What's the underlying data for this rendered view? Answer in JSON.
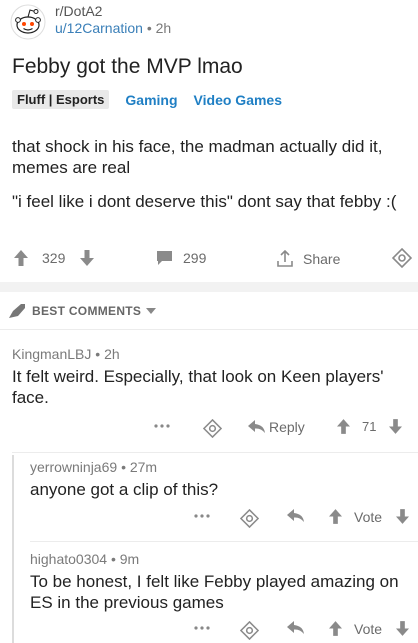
{
  "post": {
    "subreddit": "r/DotA2",
    "author": "u/12Carnation",
    "age": "2h",
    "title": "Febby got the MVP lmao",
    "flair": "Fluff | Esports",
    "tags": [
      "Gaming",
      "Video Games"
    ],
    "body": [
      "that shock in his face, the madman actually did it, memes are real",
      "\"i feel like i dont deserve this\" dont say that febby :("
    ],
    "score": "329",
    "comments": "299",
    "share_label": "Share"
  },
  "sort": {
    "label": "BEST COMMENTS"
  },
  "comments": [
    {
      "author": "KingmanLBJ",
      "age": "2h",
      "text": "It felt weird. Especially, that look on Keen players' face.",
      "reply_label": "Reply",
      "score": "71"
    },
    {
      "author": "yerrowninja69",
      "age": "27m",
      "text": "anyone got a clip of this?",
      "vote_label": "Vote"
    },
    {
      "author": "highato0304",
      "age": "9m",
      "text": "To be honest, I felt like Febby played amazing on ES in the previous games",
      "vote_label": "Vote"
    }
  ],
  "separator": "•",
  "colors": {
    "link": "#1f7fc4",
    "muted": "#6b6b6b",
    "band": "#f2f2f2"
  }
}
